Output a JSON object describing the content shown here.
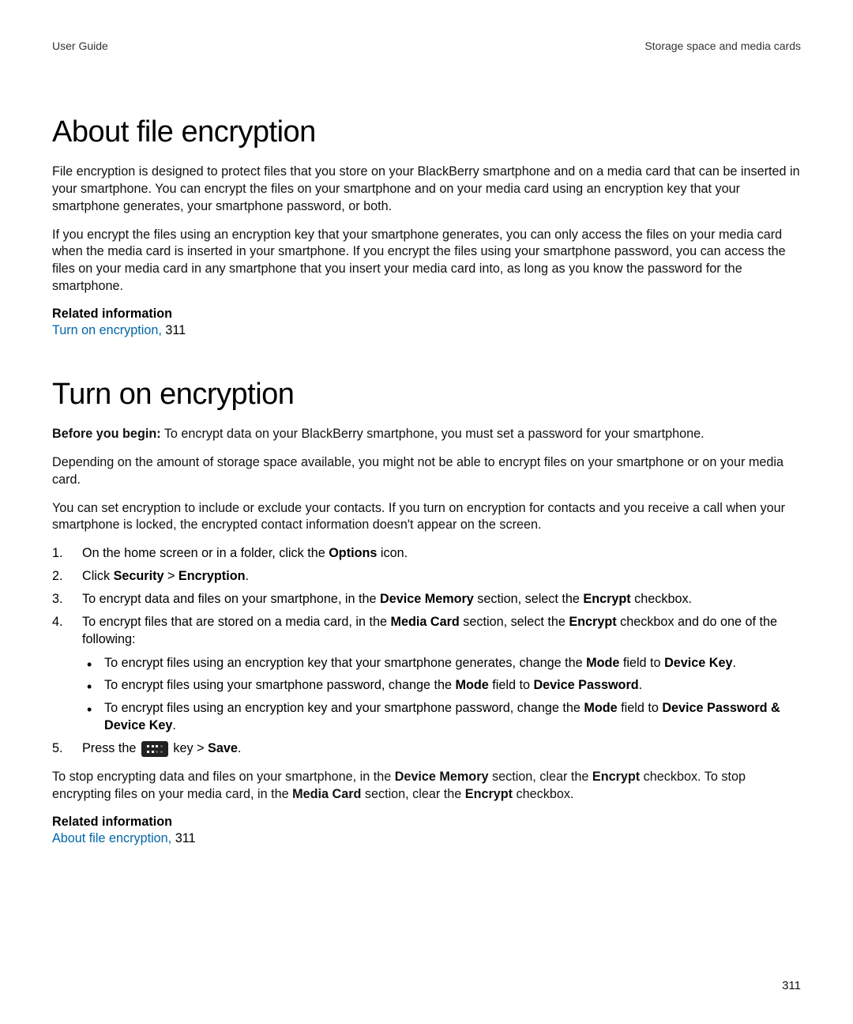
{
  "header": {
    "left": "User Guide",
    "right": "Storage space and media cards"
  },
  "section1": {
    "title": "About file encryption",
    "p1": "File encryption is designed to protect files that you store on your BlackBerry smartphone and on a media card that can be inserted in your smartphone. You can encrypt the files on your smartphone and on your media card using an encryption key that your smartphone generates, your smartphone password, or both.",
    "p2": "If you encrypt the files using an encryption key that your smartphone generates, you can only access the files on your media card when the media card is inserted in your smartphone. If you encrypt the files using your smartphone password, you can access the files on your media card in any smartphone that you insert your media card into, as long as you know the password for the smartphone.",
    "related_heading": "Related information",
    "related_link_text": "Turn on encryption,",
    "related_link_page": "311"
  },
  "section2": {
    "title": "Turn on encryption",
    "before_label": "Before you begin:",
    "before_text": " To encrypt data on your BlackBerry smartphone, you must set a password for your smartphone.",
    "p1": "Depending on the amount of storage space available, you might not be able to encrypt files on your smartphone or on your media card.",
    "p2": "You can set encryption to include or exclude your contacts. If you turn on encryption for contacts and you receive a call when your smartphone is locked, the encrypted contact information doesn't appear on the screen.",
    "step1_a": "On the home screen or in a folder, click the ",
    "step1_b": "Options",
    "step1_c": " icon.",
    "step2_a": "Click ",
    "step2_b": "Security",
    "step2_c": " > ",
    "step2_d": "Encryption",
    "step2_e": ".",
    "step3_a": "To encrypt data and files on your smartphone, in the ",
    "step3_b": "Device Memory",
    "step3_c": " section, select the ",
    "step3_d": "Encrypt",
    "step3_e": " checkbox.",
    "step4_a": "To encrypt files that are stored on a media card, in the ",
    "step4_b": "Media Card",
    "step4_c": " section, select the ",
    "step4_d": "Encrypt",
    "step4_e": " checkbox and do one of the following:",
    "bullet1_a": "To encrypt files using an encryption key that your smartphone generates, change the ",
    "bullet1_b": "Mode",
    "bullet1_c": " field to ",
    "bullet1_d": "Device Key",
    "bullet1_e": ".",
    "bullet2_a": "To encrypt files using your smartphone password, change the ",
    "bullet2_b": "Mode",
    "bullet2_c": " field to ",
    "bullet2_d": "Device Password",
    "bullet2_e": ".",
    "bullet3_a": "To encrypt files using an encryption key and your smartphone password, change the ",
    "bullet3_b": "Mode",
    "bullet3_c": " field to ",
    "bullet3_d": "Device Password & Device Key",
    "bullet3_e": ".",
    "step5_a": "Press the ",
    "step5_b": " key > ",
    "step5_c": "Save",
    "step5_d": ".",
    "closing_a": "To stop encrypting data and files on your smartphone, in the ",
    "closing_b": "Device Memory",
    "closing_c": " section, clear the ",
    "closing_d": "Encrypt",
    "closing_e": " checkbox. To stop encrypting files on your media card, in the ",
    "closing_f": "Media Card",
    "closing_g": " section, clear the ",
    "closing_h": "Encrypt",
    "closing_i": " checkbox.",
    "related_heading": "Related information",
    "related_link_text": "About file encryption,",
    "related_link_page": "311"
  },
  "page_number": "311"
}
